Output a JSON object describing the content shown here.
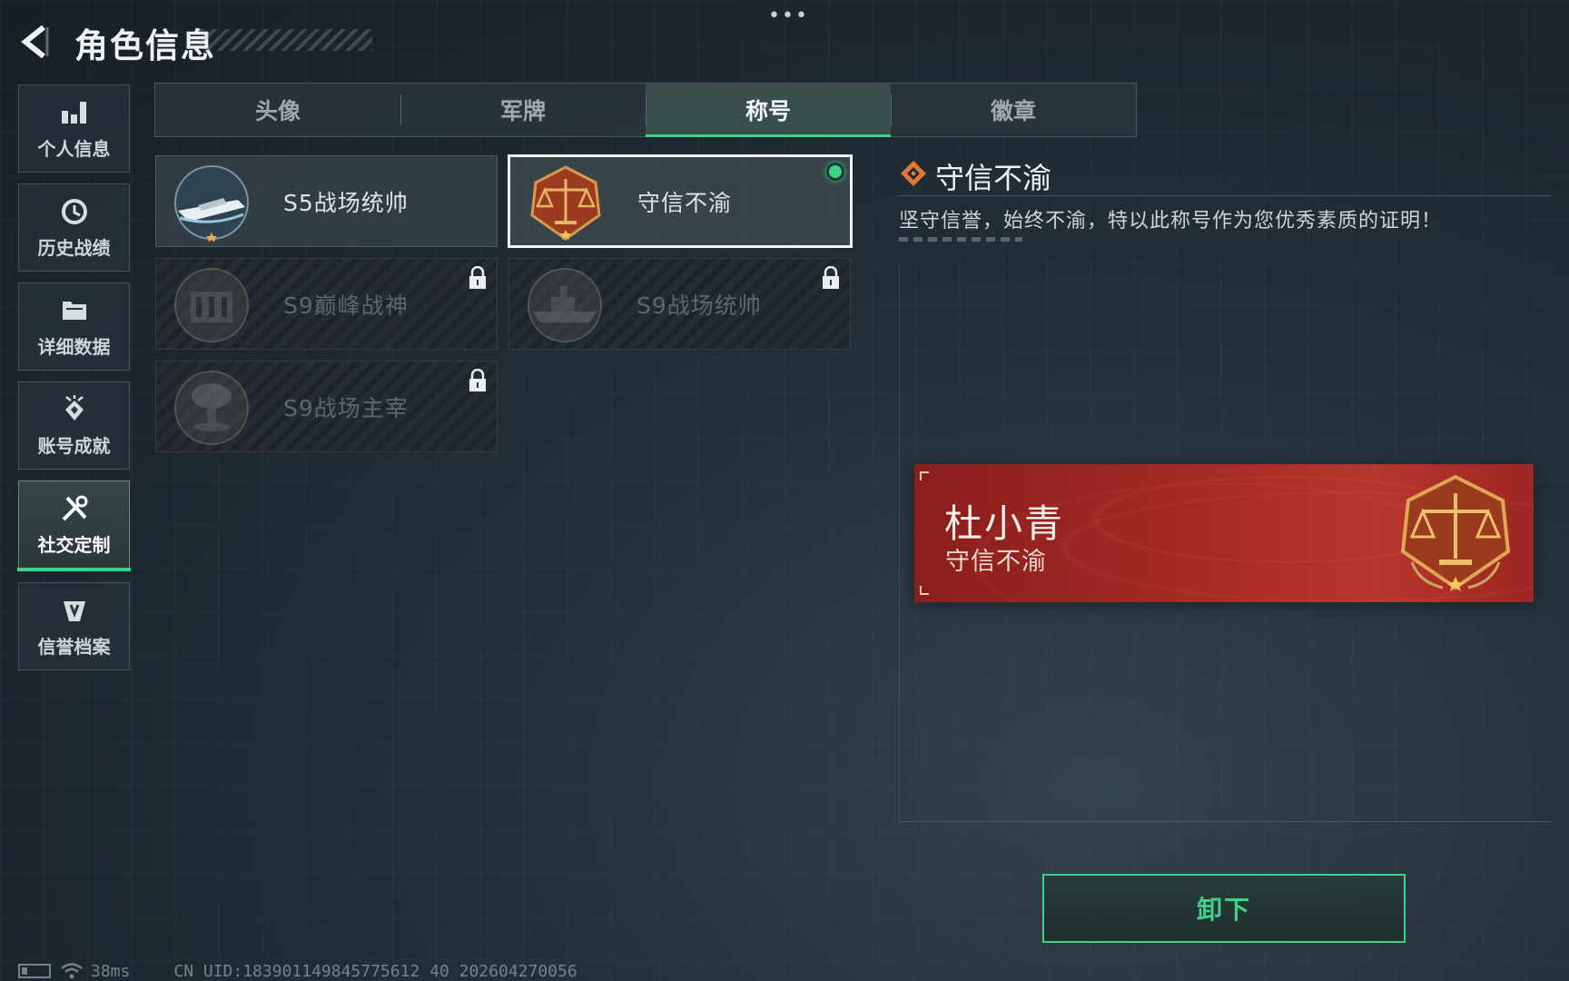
{
  "header": {
    "title": "角色信息",
    "more_label": "•••"
  },
  "sidebar": {
    "items": [
      {
        "label": "个人信息",
        "icon": "bar-chart-icon",
        "active": false
      },
      {
        "label": "历史战绩",
        "icon": "history-clock-icon",
        "active": false
      },
      {
        "label": "详细数据",
        "icon": "folder-icon",
        "active": false
      },
      {
        "label": "账号成就",
        "icon": "achievement-icon",
        "active": false
      },
      {
        "label": "社交定制",
        "icon": "tools-icon",
        "active": true
      },
      {
        "label": "信誉档案",
        "icon": "credit-shield-icon",
        "active": false
      }
    ]
  },
  "tabs": [
    {
      "label": "头像",
      "active": false
    },
    {
      "label": "军牌",
      "active": false
    },
    {
      "label": "称号",
      "active": true
    },
    {
      "label": "徽章",
      "active": false
    }
  ],
  "titles": [
    {
      "name": "S5战场统帅",
      "emblem": "speedboat-emblem-icon",
      "locked": false,
      "selected": false,
      "equipped": false
    },
    {
      "name": "守信不渝",
      "emblem": "scales-emblem-icon",
      "locked": false,
      "selected": true,
      "equipped": true
    },
    {
      "name": "S9巅峰战神",
      "emblem": "fortress-emblem-icon",
      "locked": true,
      "selected": false,
      "equipped": false
    },
    {
      "name": "S9战场统帅",
      "emblem": "warship-emblem-icon",
      "locked": true,
      "selected": false,
      "equipped": false
    },
    {
      "name": "S9战场主宰",
      "emblem": "mushroom-cloud-emblem-icon",
      "locked": true,
      "selected": false,
      "equipped": false
    }
  ],
  "detail": {
    "title": "守信不渝",
    "description": "坚守信誉，始终不渝，特以此称号作为您优秀素质的证明！"
  },
  "nameplate": {
    "player_name": "杜小青",
    "title": "守信不渝"
  },
  "action": {
    "unequip_label": "卸下"
  },
  "status": {
    "ping": "38ms",
    "uid": "CN UID:183901149845775612 40 202604270056"
  },
  "colors": {
    "accent_green": "#3fd18a",
    "plate_red": "#a52a24",
    "detail_icon_orange": "#e0783a"
  }
}
